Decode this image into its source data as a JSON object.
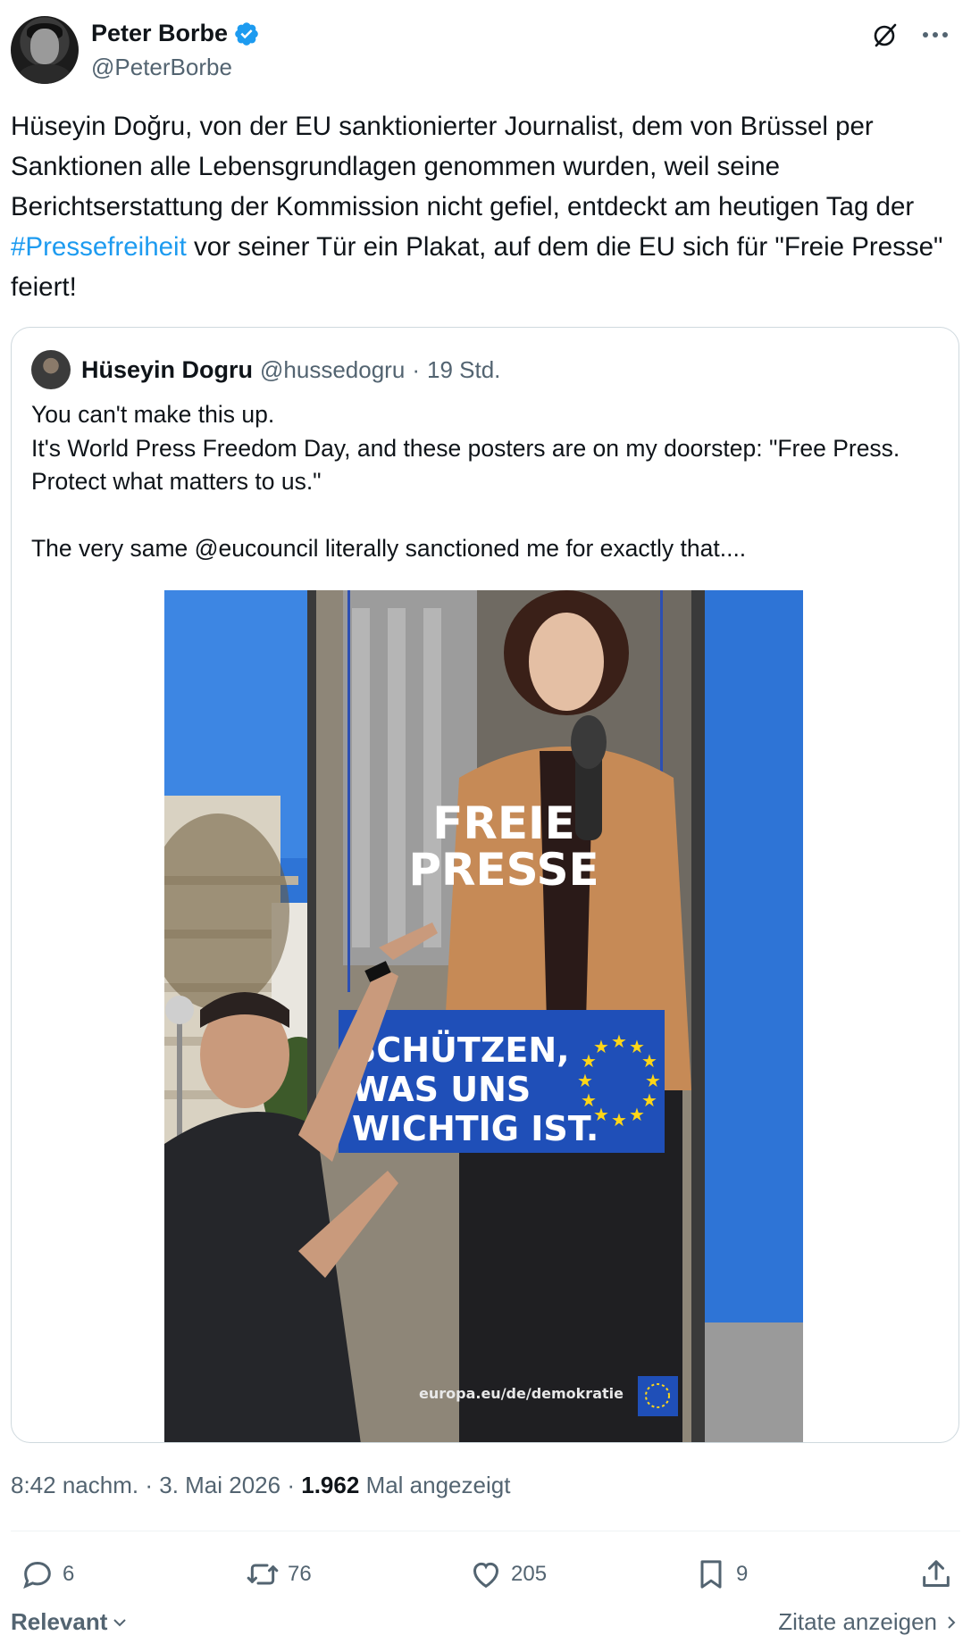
{
  "author": {
    "display_name": "Peter Borbe",
    "handle": "@PeterBorbe",
    "verified": true
  },
  "tweet": {
    "text_before_hashtag": "Hüseyin Doğru, von der EU sanktionierter Journalist, dem von Brüssel per Sanktionen alle Lebensgrundlagen genommen wurden, weil seine Berichtserstattung der Kommission nicht gefiel, entdeckt am heutigen Tag der ",
    "hashtag": "#Pressefreiheit",
    "text_after_hashtag": " vor seiner Tür ein Plakat, auf dem die EU sich für \"Freie Presse\" feiert!"
  },
  "quoted": {
    "display_name": "Hüseyin Dogru",
    "handle": "@hussedogru",
    "separator": "·",
    "time": "19 Std.",
    "lines": [
      "You can't make this up.",
      "It's World Press Freedom Day, and these posters are on my doorstep: \"Free Press. Protect what matters to us.\"",
      "",
      "The very same @eucouncil literally sanctioned me for exactly that...."
    ],
    "poster": {
      "headline_1": "FREIE",
      "headline_2": "PRESSE",
      "banner_1": "SCHÜTZEN,",
      "banner_2": "WAS UNS",
      "banner_3": "WICHTIG IST.",
      "url": "europa.eu/de/demokratie"
    }
  },
  "meta": {
    "time": "8:42 nachm.",
    "sep": "·",
    "date": "3. Mai 2026",
    "views_count": "1.962",
    "views_label": "Mal angezeigt"
  },
  "actions": {
    "replies": "6",
    "reposts": "76",
    "likes": "205",
    "bookmarks": "9"
  },
  "footer": {
    "sort_label": "Relevant",
    "quotes_label": "Zitate anzeigen"
  },
  "colors": {
    "accent": "#1d9bf0",
    "text": "#0f1419",
    "muted": "#536471",
    "border": "#cfd9de",
    "eu_blue": "#1f4fb8",
    "eu_yellow": "#ffd617"
  }
}
